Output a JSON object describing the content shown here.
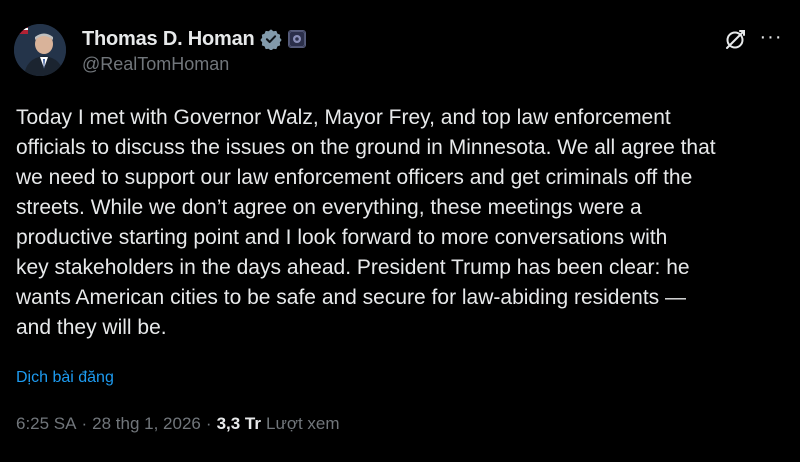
{
  "author": {
    "display_name": "Thomas D. Homan",
    "handle": "@RealTomHoman",
    "verified_icon": "gray-verified-check-icon",
    "affiliate_icon": "government-badge-icon"
  },
  "post": {
    "text": "Today I met with Governor Walz, Mayor Frey, and top law enforcement\nofficials to discuss the issues on the ground in Minnesota. We all agree that\nwe need to support our law enforcement officers and get criminals off the\nstreets. While we don’t agree on everything, these meetings were a\nproductive starting point and I look forward to more conversations with\nkey stakeholders in the days ahead. President Trump has been clear: he\nwants American cities to be safe and secure for law-abiding residents —\nand they will be.",
    "translate_label": "Dịch bài đăng"
  },
  "meta": {
    "time": "6:25 SA",
    "separator": "·",
    "date": "28 thg 1, 2026",
    "views_count": "3,3 Tr",
    "views_label": "Lượt xem"
  },
  "actions": {
    "grok_icon": "grok-icon",
    "more_icon": "more-options-icon",
    "more_glyph": "···"
  },
  "colors": {
    "background": "#000000",
    "text_primary": "#e7e9ea",
    "text_secondary": "#71767b",
    "link": "#1d9bf0"
  }
}
